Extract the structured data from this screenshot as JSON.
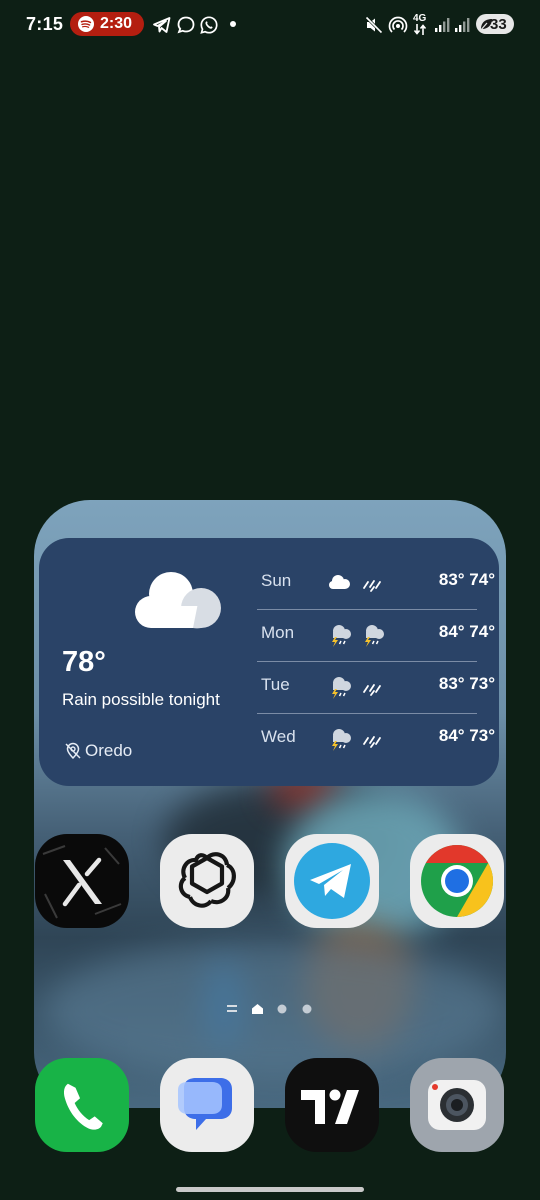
{
  "status_bar": {
    "time": "7:15",
    "spotify_timer": "2:30",
    "network": "4G",
    "battery": "33",
    "icons": [
      "spotify-icon",
      "telegram-icon",
      "chat-bubble-icon",
      "whatsapp-icon",
      "dot-icon",
      "mute-icon",
      "hotspot-icon",
      "network-4g-icon",
      "signal-icon",
      "signal-icon",
      "battery-saver-icon"
    ]
  },
  "weather_widget": {
    "current": {
      "temperature": "78°",
      "description": "Rain possible tonight",
      "location": "Oredo",
      "icon": "cloud-icon"
    },
    "forecast": [
      {
        "day": "Sun",
        "icons": [
          "cloud-icon",
          "rain-icon"
        ],
        "temps": "83° 74°"
      },
      {
        "day": "Mon",
        "icons": [
          "thunderstorm-icon",
          "thunderstorm-icon"
        ],
        "temps": "84° 74°"
      },
      {
        "day": "Tue",
        "icons": [
          "thunderstorm-icon",
          "rain-icon"
        ],
        "temps": "83° 73°"
      },
      {
        "day": "Wed",
        "icons": [
          "thunderstorm-icon",
          "rain-icon"
        ],
        "temps": "84° 73°"
      }
    ]
  },
  "home_apps": [
    "X",
    "ChatGPT",
    "Telegram",
    "Chrome"
  ],
  "dock_apps": [
    "Phone",
    "Messages",
    "TradingView",
    "Camera"
  ],
  "page_indicator": {
    "pages": 2,
    "current_page": 1
  },
  "colors": {
    "background": "#0d1f15",
    "weather_card": "#2a4367",
    "spotify_pill": "#b41e10",
    "phone_green": "#18b347",
    "telegram_blue": "#2ea8e0",
    "messages_blue": "#3d6ee8"
  }
}
